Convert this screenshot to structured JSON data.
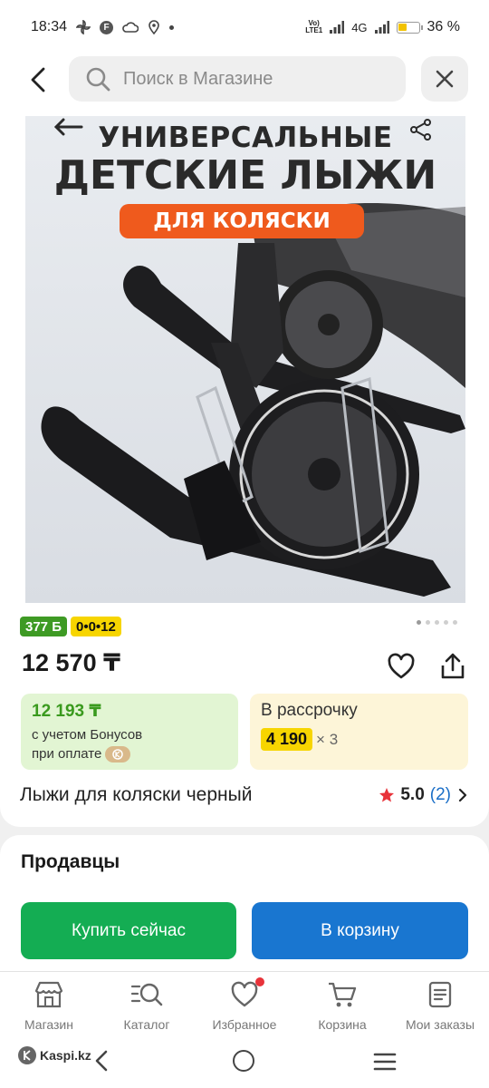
{
  "status_bar": {
    "time": "18:34",
    "network": "4G",
    "volte": "Vo) LTE1",
    "battery": "36 %",
    "icons": [
      "pinwheel-icon",
      "f-icon",
      "cloud-icon",
      "location-icon",
      "dot-icon",
      "volte-icon",
      "signal-icon",
      "battery-icon"
    ]
  },
  "header": {
    "search_placeholder": "Поиск в Магазине"
  },
  "product": {
    "image": {
      "line1": "УНИВЕРСАЛЬНЫЕ",
      "line2": "ДЕТСКИЕ ЛЫЖИ",
      "tag": "ДЛЯ КОЛЯСКИ"
    },
    "badge_bonus": "377 Б",
    "badge_installment": "0•0•12",
    "carousel_pages": 5,
    "carousel_active": 1,
    "price": "12 570 ₸",
    "bonus": {
      "price": "12 193 ₸",
      "note_line1": "с учетом Бонусов",
      "note_line2": "при оплате"
    },
    "installment": {
      "label": "В рассрочку",
      "amount": "4 190",
      "multiplier": "× 3"
    },
    "title": "Лыжи для коляски черный",
    "rating": "5.0",
    "reviews": "(2)"
  },
  "sellers": {
    "title": "Продавцы",
    "buy_now": "Купить сейчас",
    "add_to_cart": "В корзину"
  },
  "bottom_nav": {
    "items": [
      {
        "label": "Магазин",
        "icon": "store-icon"
      },
      {
        "label": "Каталог",
        "icon": "catalog-search-icon"
      },
      {
        "label": "Избранное",
        "icon": "heart-icon"
      },
      {
        "label": "Корзина",
        "icon": "cart-icon"
      },
      {
        "label": "Мои заказы",
        "icon": "orders-icon"
      }
    ]
  },
  "system_nav": {
    "kaspi_label": "Kaspi.kz"
  },
  "colors": {
    "green": "#14ad53",
    "blue": "#1976d0",
    "yellow": "#f7d500",
    "bonus_green": "#3e9a24",
    "orange_tag": "#ef5a1d",
    "star": "#e8333a"
  }
}
